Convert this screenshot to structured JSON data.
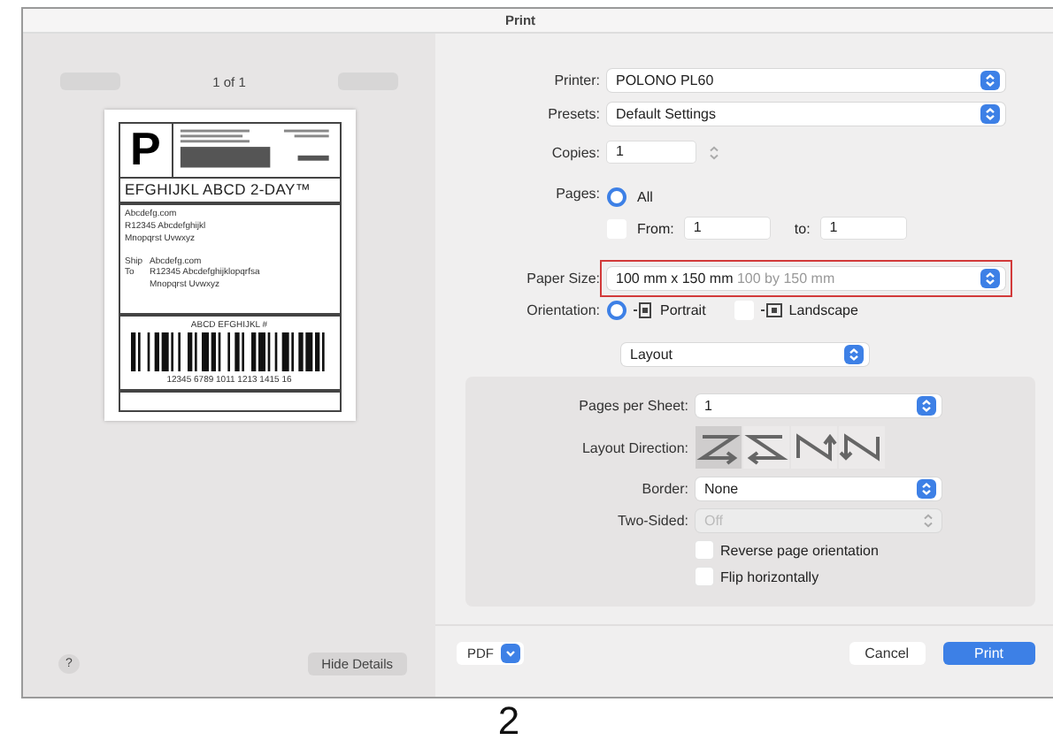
{
  "window": {
    "title": "Print"
  },
  "preview": {
    "page_indicator": "1 of 1",
    "label": {
      "service_letter": "P",
      "service_name": "EFGHIJKL ABCD 2-DAY™",
      "from_lines": [
        "Abcdefg.com",
        "R12345 Abcdefghijkl",
        "Mnopqrst Uvwxyz"
      ],
      "ship_label": "Ship",
      "to_label": "To",
      "to_lines": [
        "Abcdefg.com",
        "R12345 Abcdefghijklopqrfsa",
        "Mnopqrst Uvwxyz"
      ],
      "tracking_title": "ABCD EFGHIJKL #",
      "tracking_number": "12345 6789 1011 1213 1415 16"
    }
  },
  "left_footer": {
    "help": "?",
    "hide_details": "Hide Details"
  },
  "settings": {
    "printer": {
      "label": "Printer:",
      "value": "POLONO PL60"
    },
    "presets": {
      "label": "Presets:",
      "value": "Default Settings"
    },
    "copies": {
      "label": "Copies:",
      "value": "1"
    },
    "pages": {
      "label": "Pages:",
      "all_label": "All",
      "all_selected": true,
      "from_label": "From:",
      "from_value": "1",
      "to_label": "to:",
      "to_value": "1",
      "range_selected": false
    },
    "paper_size": {
      "label": "Paper Size:",
      "value": "100 mm x 150 mm",
      "hint": "100 by 150 mm",
      "highlighted": true
    },
    "orientation": {
      "label": "Orientation:",
      "options": [
        {
          "kind": "portrait",
          "label": "Portrait",
          "selected": true
        },
        {
          "kind": "landscape",
          "label": "Landscape",
          "selected": false
        }
      ]
    }
  },
  "section_menu": "Layout",
  "layout": {
    "pages_per_sheet": {
      "label": "Pages per Sheet:",
      "value": "1"
    },
    "layout_direction": {
      "label": "Layout Direction:",
      "options": [
        {
          "kind": "z",
          "selected": true
        },
        {
          "kind": "reverse-z",
          "selected": false
        },
        {
          "kind": "reverse-n",
          "selected": false
        },
        {
          "kind": "n",
          "selected": false
        }
      ]
    },
    "border": {
      "label": "Border:",
      "value": "None"
    },
    "two_sided": {
      "label": "Two-Sided:",
      "value": "Off",
      "disabled": true
    },
    "checkboxes": [
      {
        "label": "Reverse page orientation",
        "checked": false
      },
      {
        "label": "Flip horizontally",
        "checked": false
      }
    ]
  },
  "footer": {
    "pdf": "PDF",
    "cancel": "Cancel",
    "print": "Print"
  },
  "caption": "2"
}
